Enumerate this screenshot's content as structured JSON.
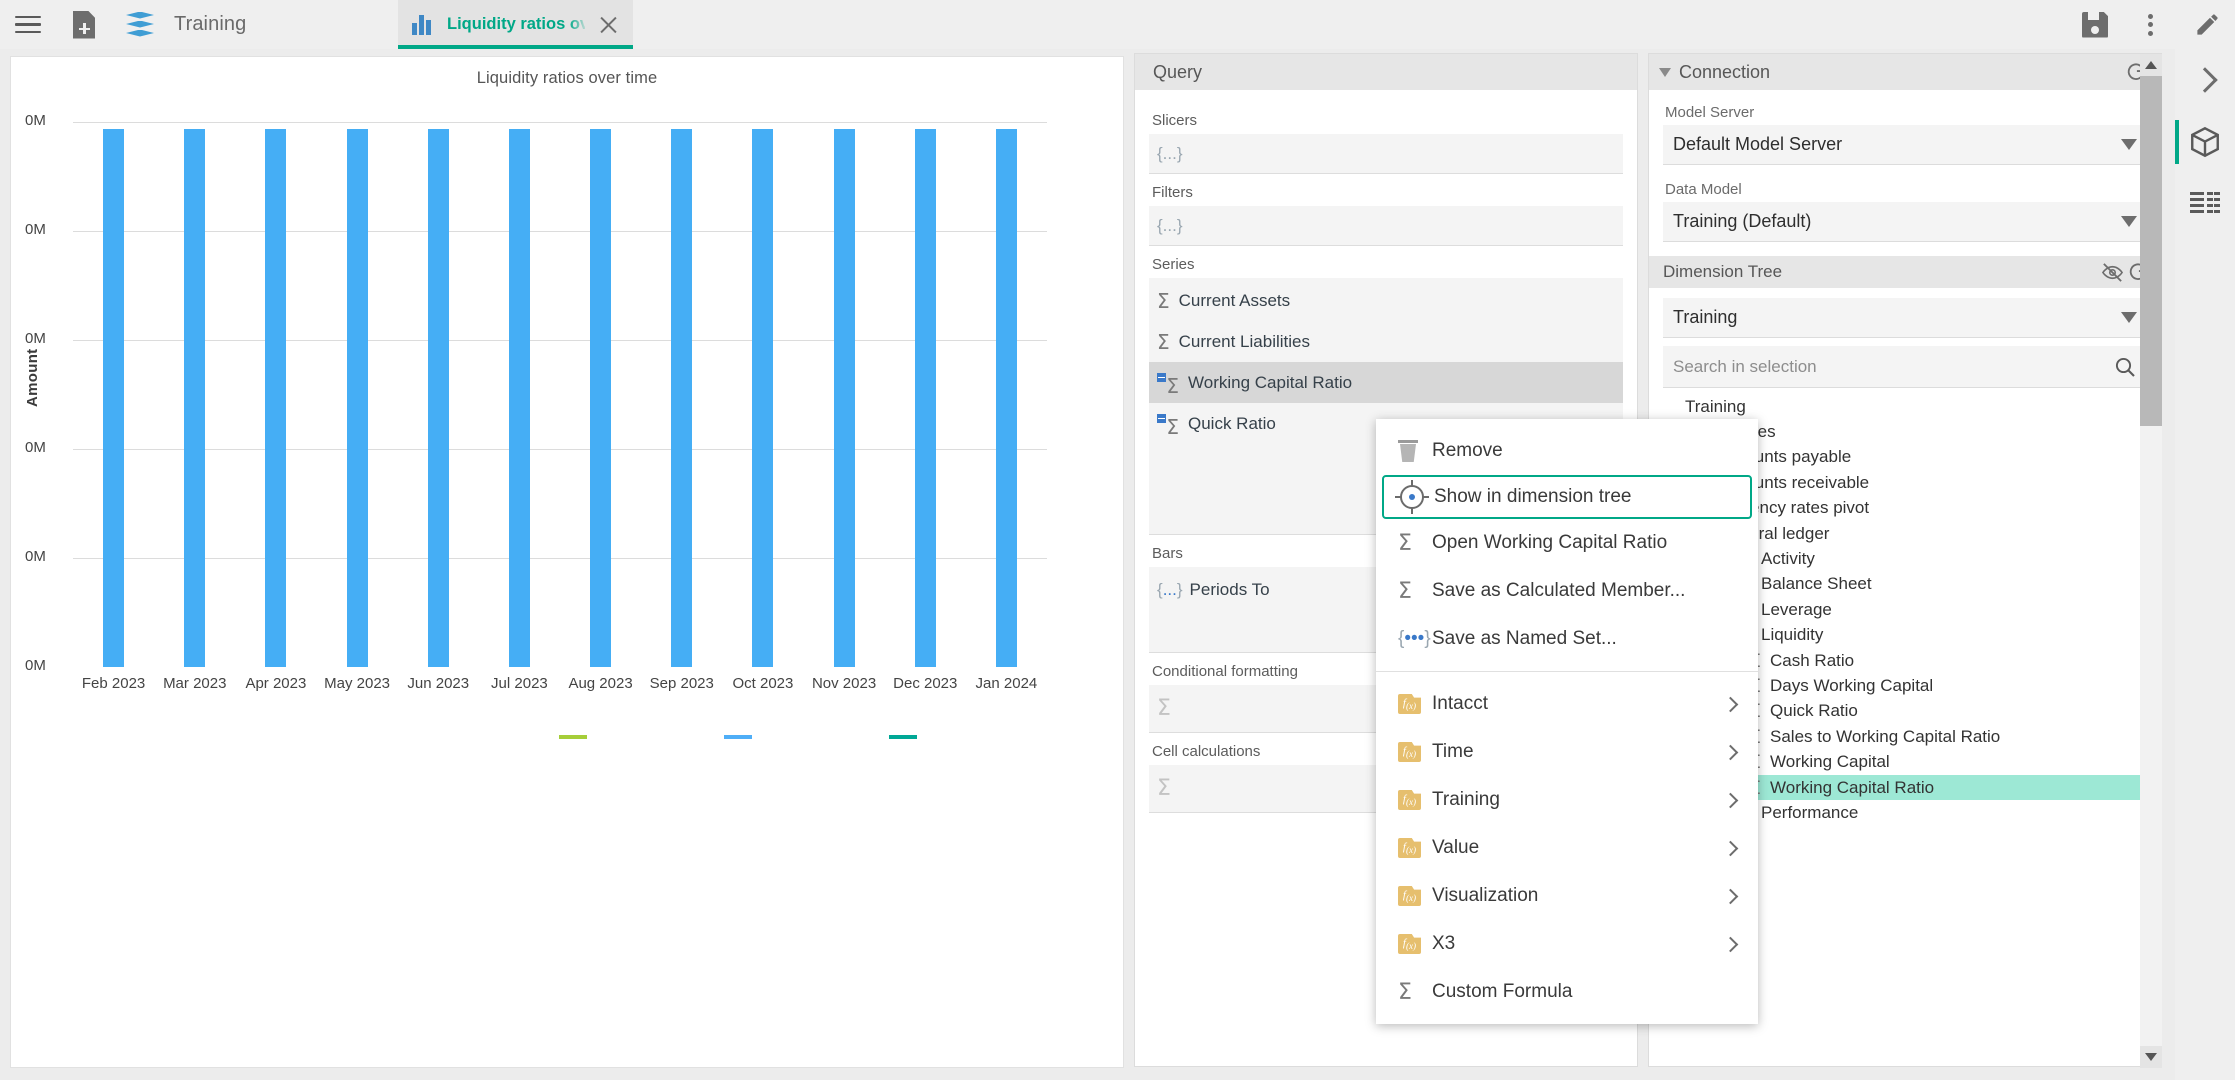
{
  "topbar": {
    "menu_icon": "hamburger-menu-icon",
    "new_document_icon": "new-document-icon",
    "model_icon": "layers-icon",
    "document_title": "Training",
    "save_icon": "save-icon",
    "more_icon": "kebab-menu-icon",
    "edit_icon": "pencil-icon"
  },
  "tab": {
    "icon": "bar-chart-icon",
    "label": "Liquidity ratios over time",
    "close_icon": "close-icon"
  },
  "rail": {
    "expand_icon": "chevron-right-icon",
    "cube_icon": "cube-icon",
    "table_icon": "table-layout-icon"
  },
  "chart_data": {
    "type": "bar",
    "title": "Liquidity ratios over time",
    "xlabel": "",
    "ylabel": "Amount",
    "categories": [
      "Feb 2023",
      "Mar 2023",
      "Apr 2023",
      "May 2023",
      "Jun 2023",
      "Jul 2023",
      "Aug 2023",
      "Sep 2023",
      "Oct 2023",
      "Nov 2023",
      "Dec 2023",
      "Jan 2024"
    ],
    "ytick_labels": [
      "0M",
      "0M",
      "0M",
      "0M",
      "0M",
      "0M"
    ],
    "ylim": [
      0,
      0
    ],
    "grid": true,
    "legend_position": "bottom",
    "series": [
      {
        "name": "Current Assets",
        "color": "#45AEF5",
        "values": [
          1,
          1,
          1,
          1,
          1,
          1,
          1,
          1,
          1,
          1,
          1,
          1
        ]
      },
      {
        "name": "Current Liabilities",
        "color": "#A6CE39",
        "values": [
          0,
          0,
          0,
          0,
          0,
          0,
          0,
          0,
          0,
          0,
          0,
          0
        ]
      },
      {
        "name": "Working Capital Ratio",
        "color": "#4FAEF7",
        "values": [
          0,
          0,
          0,
          0,
          0,
          0,
          0,
          0,
          0,
          0,
          0,
          0
        ]
      },
      {
        "name": "Quick Ratio",
        "color": "#00A896",
        "values": [
          0,
          0,
          0,
          0,
          0,
          0,
          0,
          0,
          0,
          0,
          0,
          0
        ]
      }
    ],
    "legend_marks": [
      "#A6CE39",
      "#4FAEF7",
      "#00A896"
    ]
  },
  "query": {
    "header": "Query",
    "slicers_label": "Slicers",
    "slicers_value": "{...}",
    "filters_label": "Filters",
    "filters_value": "{...}",
    "series_label": "Series",
    "series_items": [
      {
        "label": "Current Assets",
        "icon": "sigma-icon",
        "selected": false
      },
      {
        "label": "Current Liabilities",
        "icon": "sigma-icon",
        "selected": false
      },
      {
        "label": "Working Capital Ratio",
        "icon": "calculated-measure-icon",
        "selected": true
      },
      {
        "label": "Quick Ratio",
        "icon": "calculated-measure-icon",
        "selected": false
      }
    ],
    "bars_label": "Bars",
    "bars_item": "Periods To",
    "bars_item_icon": "{...}",
    "conditional_formatting_label": "Conditional formatting",
    "cell_calculations_label": "Cell calculations"
  },
  "context_menu": {
    "items": [
      {
        "label": "Remove",
        "icon": "trash-icon",
        "submenu": false,
        "highlighted": false
      },
      {
        "label": "Show in dimension tree",
        "icon": "target-icon",
        "submenu": false,
        "highlighted": true
      },
      {
        "label": "Open Working Capital Ratio",
        "icon": "sigma-icon",
        "submenu": false,
        "highlighted": false
      },
      {
        "label": "Save as Calculated Member...",
        "icon": "sigma-icon",
        "submenu": false,
        "highlighted": false
      },
      {
        "label": "Save as Named Set...",
        "icon": "braces-icon",
        "submenu": false,
        "highlighted": false
      }
    ],
    "folder_items": [
      {
        "label": "Intacct",
        "icon": "fx-folder-icon",
        "submenu": true
      },
      {
        "label": "Time",
        "icon": "fx-folder-icon",
        "submenu": true
      },
      {
        "label": "Training",
        "icon": "fx-folder-icon",
        "submenu": true
      },
      {
        "label": "Value",
        "icon": "fx-folder-icon",
        "submenu": true
      },
      {
        "label": "Visualization",
        "icon": "fx-folder-icon",
        "submenu": true
      },
      {
        "label": "X3",
        "icon": "fx-folder-icon",
        "submenu": true
      },
      {
        "label": "Custom Formula",
        "icon": "sigma-icon",
        "submenu": false
      }
    ]
  },
  "connection": {
    "header": "Connection",
    "collapse_icon": "caret-collapse-icon",
    "refresh_icon": "refresh-icon",
    "model_server_label": "Model Server",
    "model_server_value": "Default Model Server",
    "data_model_label": "Data Model",
    "data_model_value": "Training (Default)",
    "dimension_tree_header": "Dimension Tree",
    "hide_icon": "eye-off-icon",
    "tree_refresh_icon": "refresh-icon",
    "tree_select_value": "Training",
    "search_placeholder": "Search in selection",
    "search_value": "",
    "search_icon": "search-icon",
    "tree": [
      {
        "label": "Training",
        "type": "root",
        "indent": 0,
        "twisty": false,
        "selected": false
      },
      {
        "label": "Measures",
        "type": "folder-plain",
        "indent": 1,
        "twisty": false,
        "selected": false
      },
      {
        "label": "Accounts payable",
        "type": "node",
        "indent": 2,
        "twisty": false,
        "selected": false
      },
      {
        "label": "Accounts receivable",
        "type": "node",
        "indent": 2,
        "twisty": false,
        "selected": false
      },
      {
        "label": "Currency rates pivot",
        "type": "node",
        "indent": 2,
        "twisty": false,
        "selected": false
      },
      {
        "label": "General ledger",
        "type": "node",
        "indent": 2,
        "twisty": false,
        "selected": false
      },
      {
        "label": "Activity",
        "type": "folder",
        "indent": 3,
        "twisty": false,
        "selected": false
      },
      {
        "label": "Balance Sheet",
        "type": "folder",
        "indent": 3,
        "twisty": true,
        "selected": false
      },
      {
        "label": "Leverage",
        "type": "folder",
        "indent": 3,
        "twisty": false,
        "selected": false
      },
      {
        "label": "Liquidity",
        "type": "folder",
        "indent": 3,
        "twisty": false,
        "selected": false
      },
      {
        "label": "Cash Ratio",
        "type": "measure",
        "indent": 4,
        "twisty": false,
        "selected": false
      },
      {
        "label": "Days Working Capital",
        "type": "measure",
        "indent": 4,
        "twisty": false,
        "selected": false
      },
      {
        "label": "Quick Ratio",
        "type": "measure",
        "indent": 4,
        "twisty": false,
        "selected": false
      },
      {
        "label": "Sales to Working Capital Ratio",
        "type": "measure",
        "indent": 4,
        "twisty": false,
        "selected": false
      },
      {
        "label": "Working Capital",
        "type": "measure",
        "indent": 4,
        "twisty": false,
        "selected": false
      },
      {
        "label": "Working Capital Ratio",
        "type": "measure",
        "indent": 4,
        "twisty": false,
        "selected": true
      },
      {
        "label": "Performance",
        "type": "folder",
        "indent": 3,
        "twisty": true,
        "selected": false
      }
    ]
  },
  "colors": {
    "accent": "#00A887",
    "bar_blue": "#45AEF5",
    "selection": "#9de8d5"
  }
}
